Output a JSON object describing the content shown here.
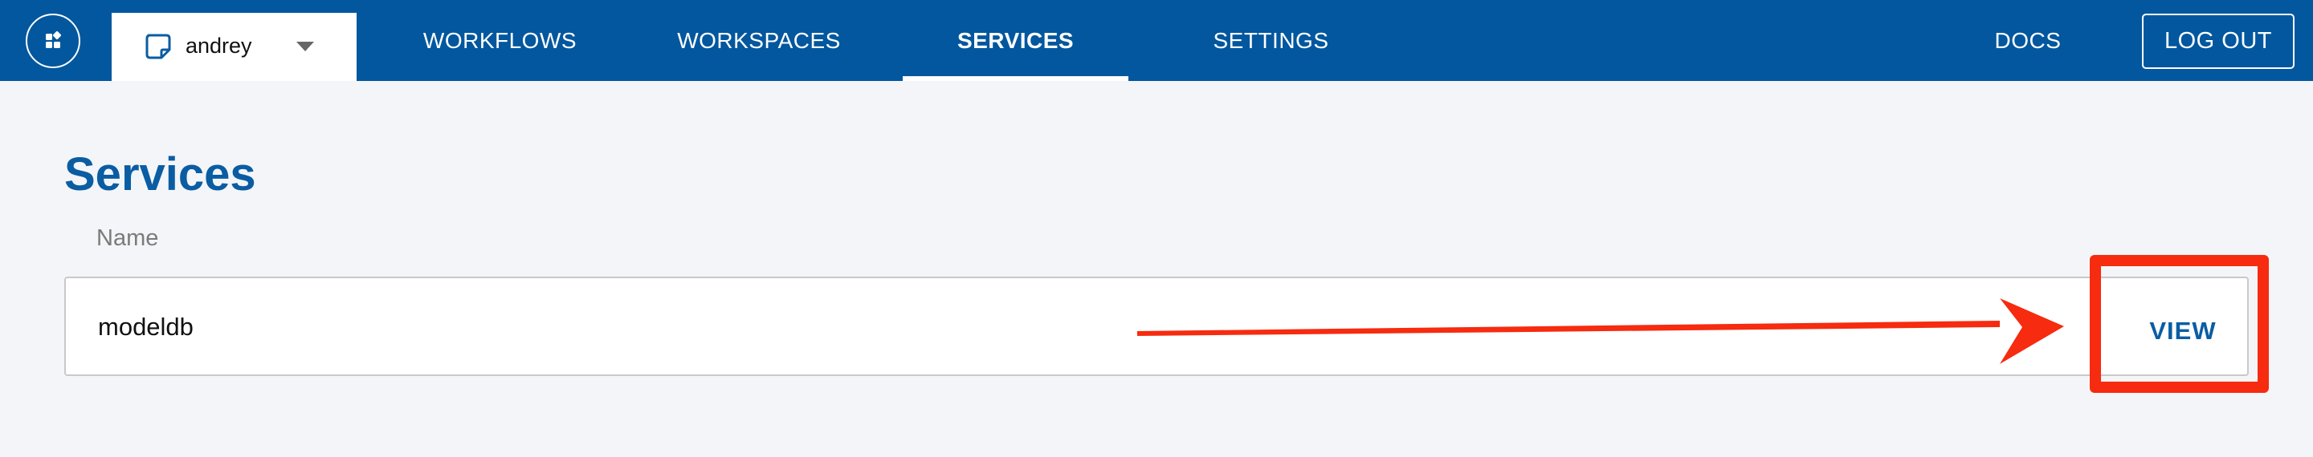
{
  "topbar": {
    "user_name": "andrey",
    "nav": [
      "WORKFLOWS",
      "WORKSPACES",
      "SERVICES",
      "SETTINGS"
    ],
    "active_nav": "SERVICES",
    "docs_label": "DOCS",
    "logout_label": "LOG OUT"
  },
  "main": {
    "title": "Services",
    "column_header": "Name",
    "rows": [
      {
        "name": "modeldb",
        "action_label": "VIEW"
      }
    ]
  },
  "colors": {
    "primary": "#02579e",
    "title": "#0a5da3",
    "background": "#f4f5f8",
    "annotation": "#f62b0f"
  },
  "icons": {
    "app_menu": "grid-icon",
    "user": "document-icon",
    "dropdown": "chevron-down-icon"
  },
  "annotations": {
    "arrow": "arrow-right",
    "highlight": "view-button-highlight"
  }
}
